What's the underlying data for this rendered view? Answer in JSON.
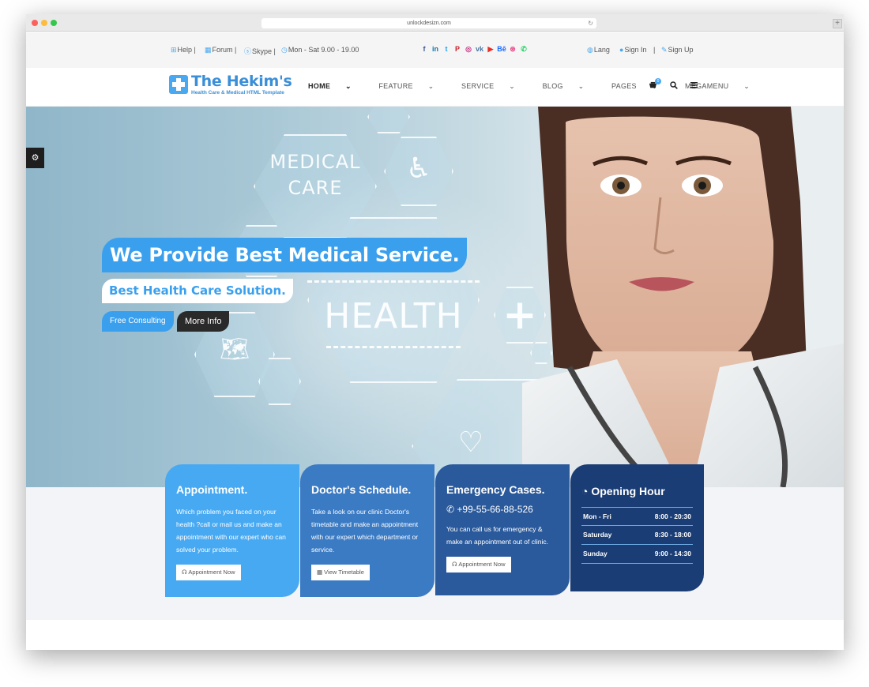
{
  "browser": {
    "url": "unlockdesizn.com"
  },
  "topbar": {
    "help": "Help |",
    "forum": "Forum |",
    "skype": "Skype |",
    "hours": "Mon - Sat 9.00 - 19.00",
    "social": [
      {
        "icon": "facebook-icon",
        "glyph": "f",
        "color": "#3b5998"
      },
      {
        "icon": "linkedin-icon",
        "glyph": "in",
        "color": "#0e76a8"
      },
      {
        "icon": "twitter-icon",
        "glyph": "t",
        "color": "#1da1f2"
      },
      {
        "icon": "pinterest-icon",
        "glyph": "P",
        "color": "#c8232c"
      },
      {
        "icon": "instagram-icon",
        "glyph": "◎",
        "color": "#c13584"
      },
      {
        "icon": "vk-icon",
        "glyph": "vk",
        "color": "#4c75a3"
      },
      {
        "icon": "youtube-icon",
        "glyph": "▶",
        "color": "#e52d27"
      },
      {
        "icon": "behance-icon",
        "glyph": "Bē",
        "color": "#1769ff"
      },
      {
        "icon": "dribbble-icon",
        "glyph": "⊛",
        "color": "#ea4c89"
      },
      {
        "icon": "whatsapp-icon",
        "glyph": "✆",
        "color": "#25d366"
      }
    ],
    "lang": "Lang",
    "sign_in": "Sign In",
    "separator": "|",
    "sign_up": "Sign Up"
  },
  "nav": {
    "logo_title": "The Hekim's",
    "logo_subtitle": "Health Care & Medical HTML Template",
    "menu": [
      "HOME",
      "FEATURE",
      "SERVICE",
      "BLOG",
      "PAGES",
      "MEGAMENU"
    ],
    "cart_count": "0"
  },
  "hero": {
    "hex_medical": "MEDICAL",
    "hex_care": "CARE",
    "hex_health": "HEALTH",
    "title": "We Provide Best Medical Service.",
    "subtitle": "Best Health Care Solution.",
    "btn_consulting": "Free Consulting",
    "btn_more": "More Info"
  },
  "cards": {
    "appointment": {
      "title": "Appointment.",
      "text": "Which problem you faced on your health ?call or mail us and make an appointment with our expert who can solved your problem.",
      "button": "Appointment Now"
    },
    "schedule": {
      "title": "Doctor's Schedule.",
      "text": "Take a look on our clinic Doctor's timetable and make an appointment with our expert which department or service.",
      "button": "View Timetable"
    },
    "emergency": {
      "title": "Emergency Cases.",
      "phone": "+99-55-66-88-526",
      "text": "You can call us for emergency & make an appointment out of clinic.",
      "button": "Appointment Now"
    },
    "opening": {
      "title": "Opening Hour",
      "rows": [
        {
          "day": "Mon - Fri",
          "time": "8:00 - 20:30"
        },
        {
          "day": "Saturday",
          "time": "8:30 - 18:00"
        },
        {
          "day": "Sunday",
          "time": "9:00 - 14:30"
        }
      ]
    }
  },
  "colors": {
    "accent": "#3aa0ee",
    "card1": "#47a9f2",
    "card2": "#3b7bc4",
    "card3": "#2a5a9c",
    "card4": "#1b3d75"
  }
}
